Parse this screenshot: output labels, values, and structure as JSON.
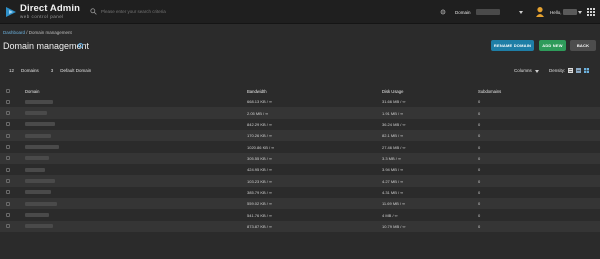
{
  "app": {
    "name": "Direct Admin",
    "tagline": "web control panel"
  },
  "search": {
    "placeholder": "Please enter your search criteria"
  },
  "topbar": {
    "domain_label": "Domain",
    "user_label": "Hello,"
  },
  "breadcrumb": {
    "home": "Dashboard",
    "sep": " / ",
    "current": "Domain management"
  },
  "page": {
    "title": "Domain management"
  },
  "actions": {
    "rename": "RENAME DOMAIN",
    "add": "ADD NEW",
    "back": "BACK"
  },
  "filters": {
    "domain_count": "12",
    "domains_label": "Domains",
    "count2": "3",
    "chip": "Default Domain"
  },
  "view": {
    "columns_label": "Columns",
    "density_label": "Density:"
  },
  "table": {
    "headers": {
      "domain": "Domain",
      "bandwidth": "Bandwidth",
      "disk": "Disk Usage",
      "subdomains": "Subdomains"
    },
    "rows": [
      {
        "bandwidth": "668.13 KB / ∞",
        "disk": "31.66 MB / ∞",
        "subdomains": "0"
      },
      {
        "bandwidth": "2.05 MB / ∞",
        "disk": "1.91 MB / ∞",
        "subdomains": "0"
      },
      {
        "bandwidth": "842.29 KB / ∞",
        "disk": "36.24 MB / ∞",
        "subdomains": "0"
      },
      {
        "bandwidth": "170.26 KB / ∞",
        "disk": "82.1 MB / ∞",
        "subdomains": "0"
      },
      {
        "bandwidth": "1020.86 KB / ∞",
        "disk": "27.46 MB / ∞",
        "subdomains": "0"
      },
      {
        "bandwidth": "305.55 KB / ∞",
        "disk": "3.3 MB / ∞",
        "subdomains": "0"
      },
      {
        "bandwidth": "424.95 KB / ∞",
        "disk": "3.94 MB / ∞",
        "subdomains": "0"
      },
      {
        "bandwidth": "103.23 KB / ∞",
        "disk": "4.27 MB / ∞",
        "subdomains": "0"
      },
      {
        "bandwidth": "385.79 KB / ∞",
        "disk": "4.31 MB / ∞",
        "subdomains": "0"
      },
      {
        "bandwidth": "559.02 KB / ∞",
        "disk": "11.69 MB / ∞",
        "subdomains": "0"
      },
      {
        "bandwidth": "541.76 KB / ∞",
        "disk": "4 MB / ∞",
        "subdomains": "0"
      },
      {
        "bandwidth": "873.87 KB / ∞",
        "disk": "10.79 MB / ∞",
        "subdomains": "0"
      }
    ]
  },
  "colors": {
    "accent": "#1e7ea6",
    "success": "#2e9b5a",
    "bg": "#2b2b2b",
    "topbar": "#1f1f1f"
  }
}
